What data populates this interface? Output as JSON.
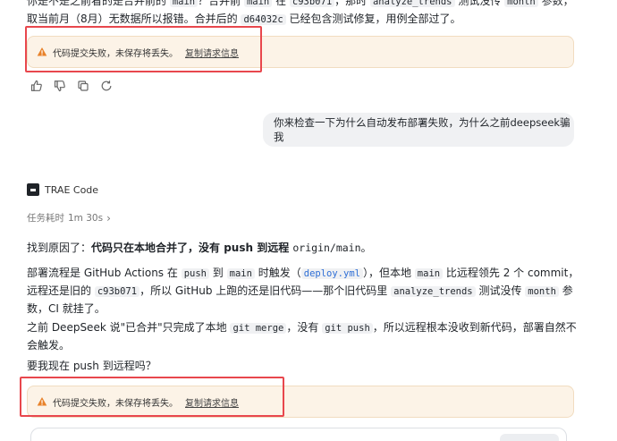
{
  "top_paragraph": {
    "t1": "你是不是之前看的是合并前的 ",
    "c1": "main",
    "t2": "？合并前 ",
    "c2": "main",
    "t3": " 在 ",
    "c3": "c93b071",
    "t4": "，那时 ",
    "c4": "analyze_trends",
    "t5": " 测试没传 ",
    "c5": "month",
    "t6": " 参数，取当前月（8月）无数据所以报错。合并后的 ",
    "c6": "d64032c",
    "t7": " 已经包含测试修复，用例全部过了。"
  },
  "warning": {
    "message": "代码提交失败，未保存将丢失。",
    "copy_link": "复制请求信息"
  },
  "user_message": "你来检查一下为什么自动发布部署失败，为什么之前deepseek骗我",
  "agent": {
    "name": "TRAE Code",
    "task_time_label": "任务耗时",
    "task_time_value": "1m 30s",
    "chevron": "›"
  },
  "answer": {
    "p1_a": "找到原因了：",
    "p1_b": "代码只在本地合并了，没有 push 到远程 ",
    "p1_c": "origin/main",
    "p1_d": "。",
    "p2_a": "部署流程是 GitHub Actions 在 ",
    "p2_c1": "push",
    "p2_b": " 到 ",
    "p2_c2": "main",
    "p2_c": " 时触发（",
    "p2_link": "deploy.yml",
    "p2_d": "），但本地 ",
    "p2_c3": "main",
    "p2_e": " 比远程领先 2 个 commit，远程还是旧的 ",
    "p2_c4": "c93b071",
    "p2_f": "，所以 GitHub 上跑的还是旧代码——那个旧代码里 ",
    "p2_c5": "analyze_trends",
    "p2_g": " 测试没传 ",
    "p2_c6": "month",
    "p2_h": " 参数，CI 就挂了。",
    "p3_a": "之前 DeepSeek 说\"已合并\"只完成了本地 ",
    "p3_c1": "git merge",
    "p3_b": "，没有 ",
    "p3_c2": "git push",
    "p3_c": "，所以远程根本没收到新代码，部署自然不会触发。",
    "p4": "要我现在 push 到远程吗？"
  },
  "colors": {
    "warning_bg": "#fcf3e7",
    "warning_icon": "#e8822a",
    "highlight_border": "#e8474d",
    "link": "#2f6fd6"
  },
  "icons": [
    "thumbs-up-icon",
    "thumbs-down-icon",
    "copy-icon",
    "refresh-icon",
    "warning-icon",
    "trae-logo-icon",
    "chevron-right-icon"
  ]
}
